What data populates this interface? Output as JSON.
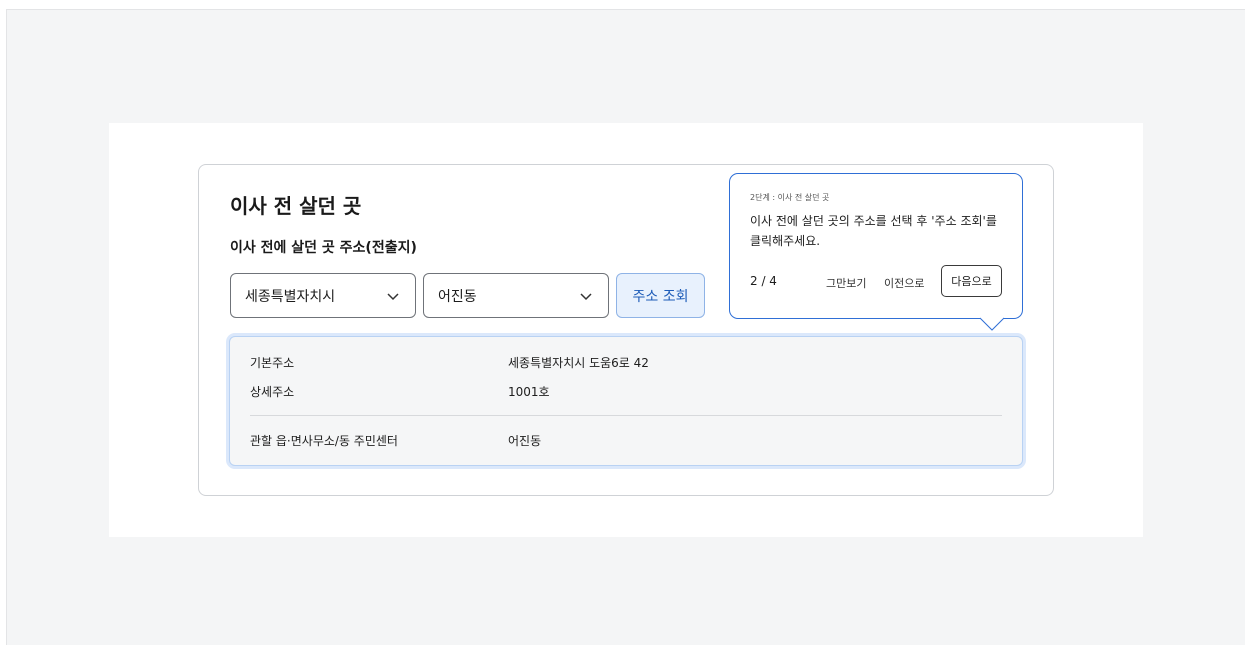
{
  "section": {
    "title": "이사 전 살던 곳",
    "subtitle": "이사 전에 살던 곳 주소(전출지)"
  },
  "filters": {
    "city_value": "세종특별자치시",
    "dong_value": "어진동",
    "lookup_label": "주소 조회"
  },
  "result": {
    "rows": [
      {
        "key": "기본주소",
        "value": "세종특별자치시 도움6로 42"
      },
      {
        "key": "상세주소",
        "value": "1001호"
      },
      {
        "key": "관할 읍·면사무소/동 주민센터",
        "value": "어진동"
      }
    ]
  },
  "tooltip": {
    "step_label": "2단계 : 이사 전 살던 곳",
    "message": "이사 전에 살던 곳의 주소를 선택 후 '주소 조회'를 클릭해주세요.",
    "page": "2 / 4",
    "close_label": "그만보기",
    "prev_label": "이전으로",
    "next_label": "다음으로",
    "accent_color": "#2f6fd6"
  }
}
